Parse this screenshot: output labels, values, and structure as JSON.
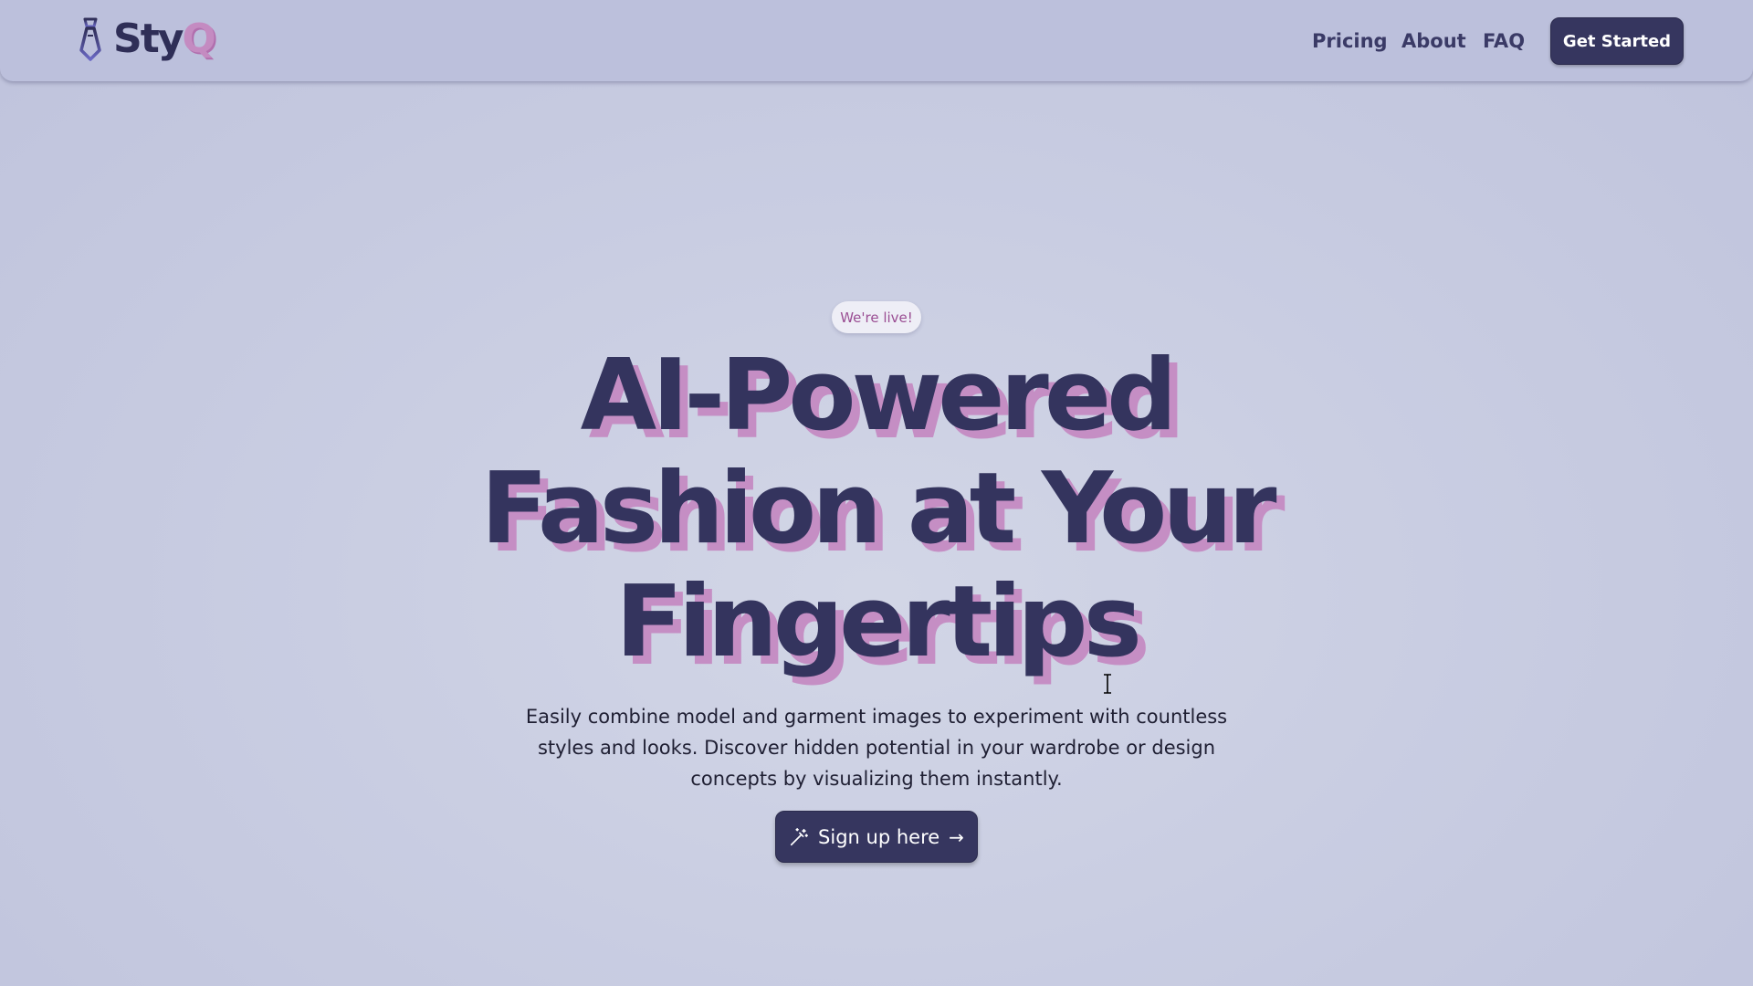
{
  "brand": {
    "name_prefix": "Sty",
    "name_suffix": "Q"
  },
  "nav": {
    "links": [
      {
        "label": "Pricing"
      },
      {
        "label": "About"
      },
      {
        "label": "FAQ"
      }
    ],
    "cta_label": "Get Started"
  },
  "hero": {
    "badge": "We're live!",
    "title_lines": [
      "AI-Powered",
      "Fashion at Your",
      "Fingertips"
    ],
    "description": "Easily combine model and garment images to experiment with countless styles and looks. Discover hidden potential in your wardrobe or design concepts by visualizing them instantly.",
    "cta_label": "Sign up here",
    "cta_arrow": "→"
  },
  "icons": {
    "logo": "tie-icon",
    "cta": "magic-wand-icon"
  },
  "colors": {
    "background": "#c9cde2",
    "navbar": "#bcc0dc",
    "primary_dark": "#36365f",
    "accent_pink": "#c58ec4",
    "badge_text": "#9a4e93"
  }
}
